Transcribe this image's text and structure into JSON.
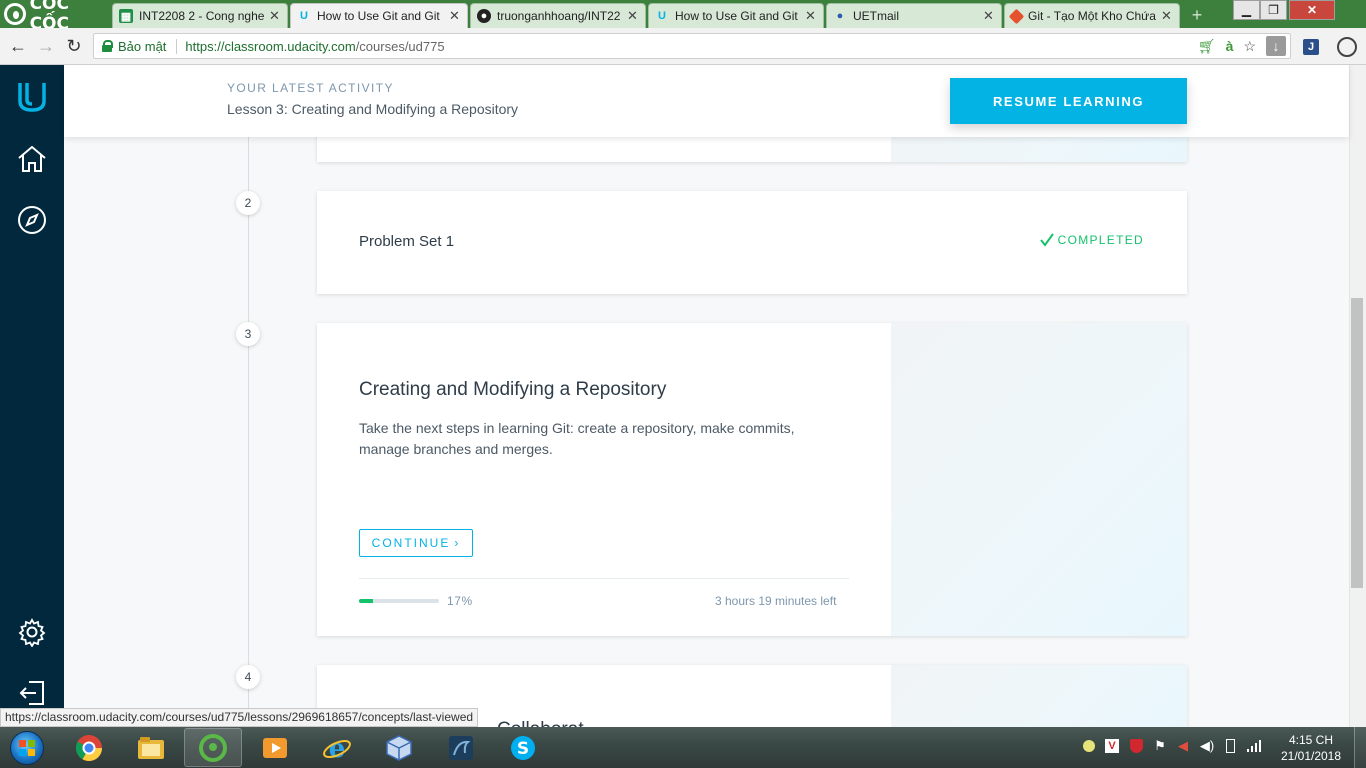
{
  "browser": {
    "brand": "CỐC CỐC",
    "tabs": [
      {
        "title": "INT2208 2 - Cong nghe",
        "icon": "sheets-icon"
      },
      {
        "title": "How to Use Git and Git",
        "icon": "udacity-icon",
        "active": true
      },
      {
        "title": "truonganhhoang/INT22",
        "icon": "github-icon"
      },
      {
        "title": "How to Use Git and Git",
        "icon": "udacity-icon"
      },
      {
        "title": "UETmail",
        "icon": "mail-icon"
      },
      {
        "title": "Git - Tạo Một Kho Chứa",
        "icon": "git-icon"
      }
    ],
    "close_glyph": "✕",
    "secure_label": "Bảo mật",
    "url_host": "https://classroom.udacity.com",
    "url_path": "/courses/ud775",
    "status_url": "https://classroom.udacity.com/courses/ud775/lessons/2969618657/concepts/last-viewed"
  },
  "activity": {
    "label": "YOUR LATEST ACTIVITY",
    "title": "Lesson 3: Creating and Modifying a Repository",
    "resume_label": "RESUME LEARNING"
  },
  "steps": [
    {
      "number": "2",
      "title": "Problem Set 1",
      "status": "COMPLETED"
    },
    {
      "number": "3",
      "title": "Creating and Modifying a Repository",
      "description": "Take the next steps in learning Git: create a repository, make commits, manage branches and merges.",
      "continue_label": "CONTINUE",
      "progress": 0.17,
      "progress_label": "17%",
      "time_left": "3 hours 19 minutes left"
    },
    {
      "number": "4",
      "title_partial": "Collaborat"
    }
  ],
  "taskbar": {
    "time": "4:15 CH",
    "date": "21/01/2018"
  },
  "colors": {
    "accent": "#02b3e4",
    "sidebar": "#02283d",
    "success": "#15c26b",
    "browser_green": "#3d7f3c"
  }
}
